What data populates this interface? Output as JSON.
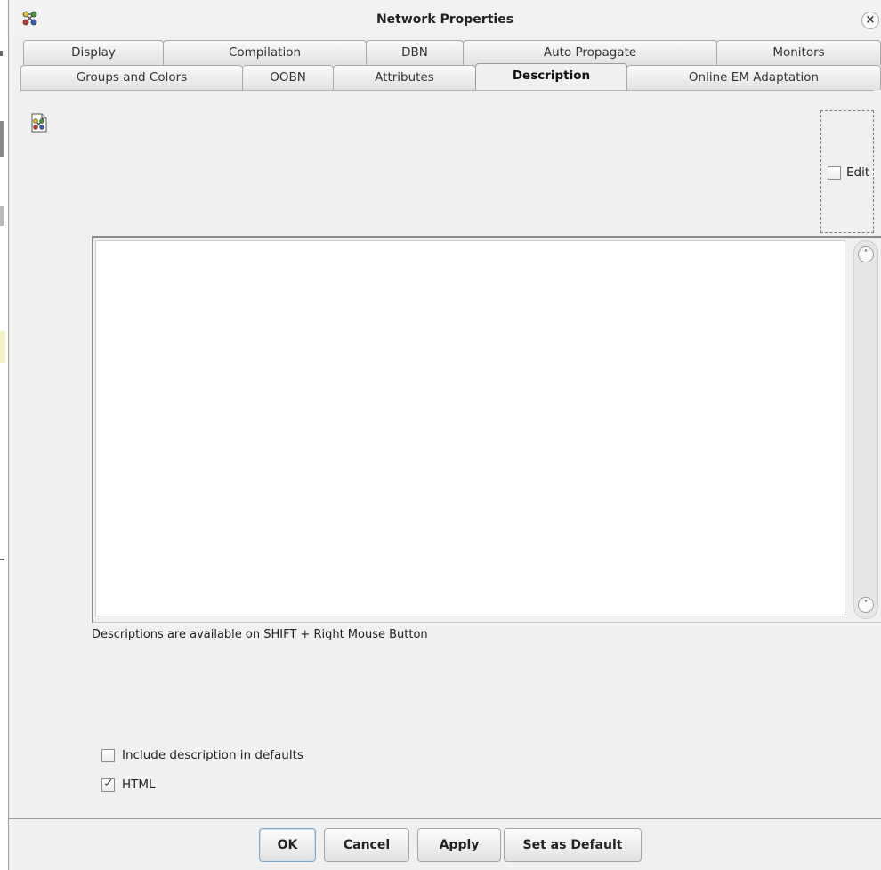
{
  "window": {
    "title": "Network Properties",
    "close_glyph": "×",
    "app_icon": "network-nodes-icon"
  },
  "tabs": {
    "row1": [
      "Display",
      "Compilation",
      "DBN",
      "Auto Propagate",
      "Monitors"
    ],
    "row2": [
      "Groups and Colors",
      "OOBN",
      "Attributes",
      "Description",
      "Online EM Adaptation"
    ],
    "active": "Description"
  },
  "description": {
    "edit_label": "Edit",
    "edit_checked": false,
    "text_value": "",
    "hint": "Descriptions are available on SHIFT + Right Mouse Button",
    "scroll_up_glyph": "˄",
    "scroll_down_glyph": "˅"
  },
  "options": {
    "include_defaults_label": "Include description in defaults",
    "include_defaults_checked": false,
    "html_label": "HTML",
    "html_checked": true,
    "check_glyph": "✓"
  },
  "buttons": {
    "ok": "OK",
    "cancel": "Cancel",
    "apply": "Apply",
    "set_default": "Set as Default"
  },
  "colors": {
    "dialog_bg": "#f0f0f0",
    "default_button_border": "#7fa7c9"
  }
}
